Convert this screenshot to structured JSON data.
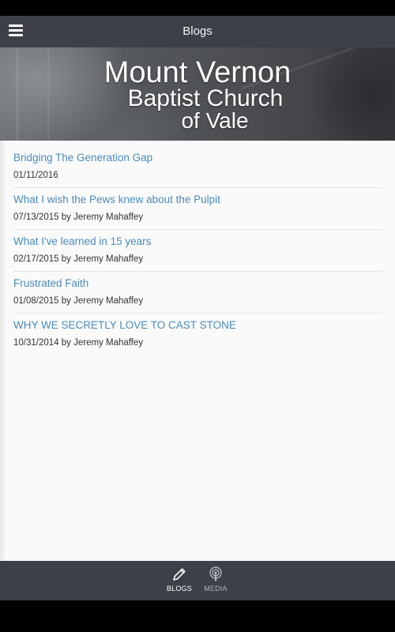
{
  "header": {
    "title": "Blogs",
    "menu_icon": "hamburger-icon"
  },
  "hero": {
    "line1": "Mount Vernon",
    "line2": "Baptist Church",
    "line3": "of Vale"
  },
  "posts": [
    {
      "title": "Bridging The Generation Gap",
      "meta": "01/11/2016"
    },
    {
      "title": "What I wish the Pews knew about the Pulpit",
      "meta": "07/13/2015 by Jeremy Mahaffey"
    },
    {
      "title": "What I've learned in 15 years",
      "meta": "02/17/2015 by Jeremy Mahaffey"
    },
    {
      "title": "Frustrated Faith",
      "meta": "01/08/2015 by Jeremy Mahaffey"
    },
    {
      "title": "WHY WE SECRETLY LOVE TO CAST STONE",
      "meta": "10/31/2014 by Jeremy Mahaffey"
    }
  ],
  "tabs": [
    {
      "label": "BLOGS",
      "icon": "pencil-icon",
      "active": true
    },
    {
      "label": "MEDIA",
      "icon": "podcast-icon",
      "active": false
    }
  ],
  "colors": {
    "bar": "#3d4048",
    "link": "#4a8bbd",
    "content_bg": "#fafafa"
  }
}
